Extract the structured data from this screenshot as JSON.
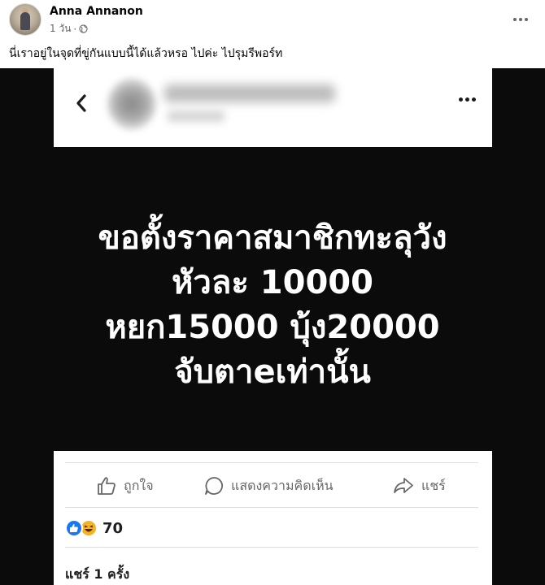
{
  "post": {
    "author": "Anna Annanon",
    "time": "1 วัน",
    "separator": "·",
    "audience_icon": "globe-icon",
    "caption": "นี่เราอยู่ในจุดที่ขู่กันแบบนี้ได้แล้วหรอ ไปค่ะ ไปรุมรีพอร์ท"
  },
  "screenshot": {
    "lines": [
      "ขอตั้งราคาสมาชิกทะลุวัง",
      "หัวละ 10000",
      "หยก15000 บุ้ง20000",
      "จับตาeเท่านั้น"
    ],
    "actions": {
      "like": "ถูกใจ",
      "comment": "แสดงความคิดเห็น",
      "share": "แชร์"
    },
    "reaction_count": "70",
    "share_count": "แชร์ 1 ครั้ง"
  },
  "colors": {
    "background_dark": "#0b0b0b",
    "text_secondary": "#65676b",
    "like_blue": "#1877f2",
    "haha_yellow": "#f7b125"
  }
}
